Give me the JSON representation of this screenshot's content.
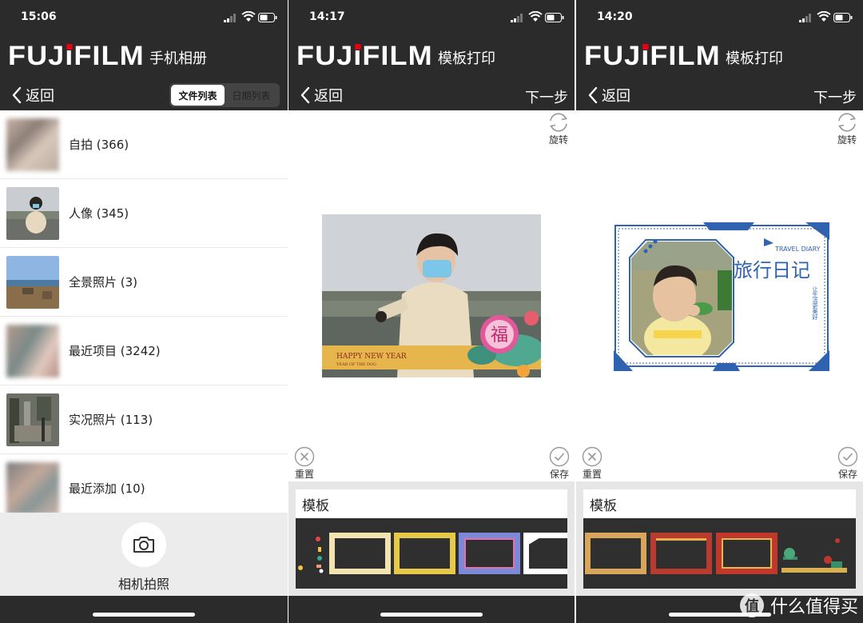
{
  "brand": {
    "logo_text": "FUJIFILM"
  },
  "screens": [
    {
      "time": "15:06",
      "header_title": "手机相册",
      "back_label": "返回",
      "segment": {
        "active": "文件列表",
        "inactive": "日期列表"
      },
      "albums": [
        {
          "name": "自拍 (366)",
          "thumb": "blurred-thumbnail"
        },
        {
          "name": "人像 (345)",
          "thumb": "child-photo"
        },
        {
          "name": "全景照片 (3)",
          "thumb": "beach-photo"
        },
        {
          "name": "最近项目 (3242)",
          "thumb": "blurred-thumbnail"
        },
        {
          "name": "实况照片 (113)",
          "thumb": "construction-photo"
        },
        {
          "name": "最近添加 (10)",
          "thumb": "blurred-thumbnail"
        }
      ],
      "camera_label": "相机拍照"
    },
    {
      "time": "14:17",
      "header_title": "模板打印",
      "back_label": "返回",
      "next_label": "下一步",
      "rotate_label": "旋转",
      "reset_label": "重置",
      "save_label": "保存",
      "template_title": "模板",
      "photo_caption_1": "HAPPY NEW YEAR",
      "photo_caption_2": "YEAR OF THE DOG",
      "fu_char": "福"
    },
    {
      "time": "14:20",
      "header_title": "模板打印",
      "back_label": "返回",
      "next_label": "下一步",
      "rotate_label": "旋转",
      "reset_label": "重置",
      "save_label": "保存",
      "template_title": "模板",
      "frame_title_en": "TRAVEL DIARY",
      "frame_title_cn": "旅行日记",
      "frame_sub_cn": "让生活更美好"
    }
  ],
  "watermark": {
    "badge": "值",
    "text": "什么值得买"
  },
  "colors": {
    "header_bg": "#2b2b2b",
    "fuji_red": "#e60012",
    "travel_blue": "#2f63b0"
  }
}
